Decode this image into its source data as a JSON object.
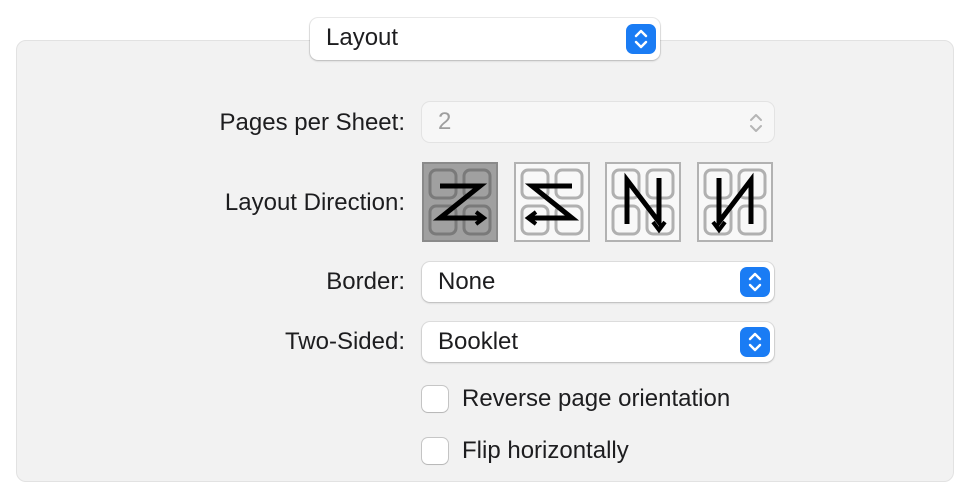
{
  "menu": {
    "selected": "Layout"
  },
  "form": {
    "pages_per_sheet": {
      "label": "Pages per Sheet:",
      "value": "2",
      "enabled": false
    },
    "layout_direction": {
      "label": "Layout Direction:",
      "options": [
        {
          "icon": "z-direction-icon",
          "selected": true
        },
        {
          "icon": "reverse-z-direction-icon",
          "selected": false
        },
        {
          "icon": "reverse-n-direction-icon",
          "selected": false
        },
        {
          "icon": "n-direction-icon",
          "selected": false
        }
      ]
    },
    "border": {
      "label": "Border:",
      "value": "None"
    },
    "two_sided": {
      "label": "Two-Sided:",
      "value": "Booklet"
    },
    "reverse_orientation": {
      "label": "Reverse page orientation",
      "checked": false
    },
    "flip_horizontally": {
      "label": "Flip horizontally",
      "checked": false
    }
  },
  "colors": {
    "accent": "#1a7cf4",
    "panel": "#f2f2f2",
    "selected_tile": "#a0a0a0"
  }
}
